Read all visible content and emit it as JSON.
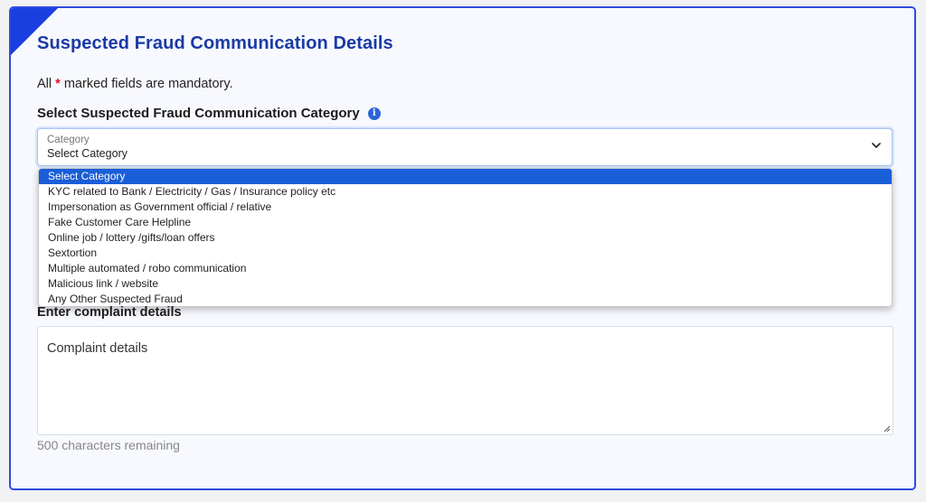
{
  "form": {
    "title": "Suspected Fraud Communication Details",
    "mandatory_prefix": "All ",
    "mandatory_star": "*",
    "mandatory_suffix": " marked fields are mandatory.",
    "category_label": "Select Suspected Fraud Communication Category",
    "info_icon": "i",
    "select": {
      "float_label": "Category",
      "value": "Select Category",
      "icon": "chevron-down-icon"
    },
    "options": [
      "Select Category",
      "KYC related to Bank / Electricity / Gas / Insurance policy etc",
      "Impersonation as Government official / relative",
      "Fake Customer Care Helpline",
      "Online job / lottery /gifts/loan offers",
      "Sextortion",
      "Multiple automated / robo communication",
      "Malicious link / website",
      "Any Other Suspected Fraud"
    ],
    "details_label": "Enter complaint details",
    "details_placeholder": "Complaint details",
    "remaining": "500 characters remaining"
  },
  "colors": {
    "accent": "#1a3fe0",
    "title": "#1b3aa6",
    "selected_option": "#1a5ed8",
    "required_star": "#e0102a"
  }
}
